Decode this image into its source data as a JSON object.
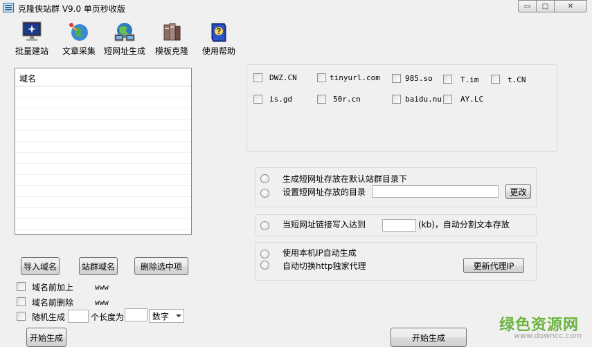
{
  "window": {
    "title": "克隆侠站群 V9.0 单页秒收版",
    "minimize_glyph": "▭",
    "maximize_glyph": "□",
    "close_glyph": "✕"
  },
  "toolbar": {
    "items": [
      {
        "label": "批量建站",
        "icon": "monitor-icon"
      },
      {
        "label": "文章采集",
        "icon": "globe-icon"
      },
      {
        "label": "短网址生成",
        "icon": "network-icon"
      },
      {
        "label": "模板克隆",
        "icon": "books-icon"
      },
      {
        "label": "使用帮助",
        "icon": "help-book-icon"
      }
    ]
  },
  "domain_list": {
    "header": "域名"
  },
  "domain_buttons": {
    "import": "导入域名",
    "site_group": "站群域名",
    "delete_selected": "删除选中项"
  },
  "options": {
    "prefix_add_label": "域名前加上",
    "prefix_add_value": "www",
    "prefix_remove_label": "域名前删除",
    "prefix_remove_value": "www",
    "random_label": "随机生成",
    "length_label": "个长度为",
    "type_value": "数字"
  },
  "start_left": "开始生成",
  "shorteners": [
    "DWZ.CN",
    "tinyurl.com",
    "985.so",
    "T.im",
    "t.CN",
    "is.gd",
    "50r.cn",
    "baidu.nu",
    "AY.LC"
  ],
  "save_group": {
    "default_dir_label": "生成短网址存放在默认站群目录下",
    "custom_dir_label": "设置短网址存放的目录",
    "change_button": "更改"
  },
  "split_group": {
    "label_before": "当短网址链接写入达到",
    "label_after": "(kb)，自动分割文本存放"
  },
  "proxy_group": {
    "local_ip_label": "使用本机IP自动生成",
    "proxy_label": "自动切换http独家代理",
    "update_button": "更新代理IP"
  },
  "start_right": "开始生成",
  "watermark": {
    "logo": "绿色资源网",
    "url": "www.downcc.com"
  }
}
